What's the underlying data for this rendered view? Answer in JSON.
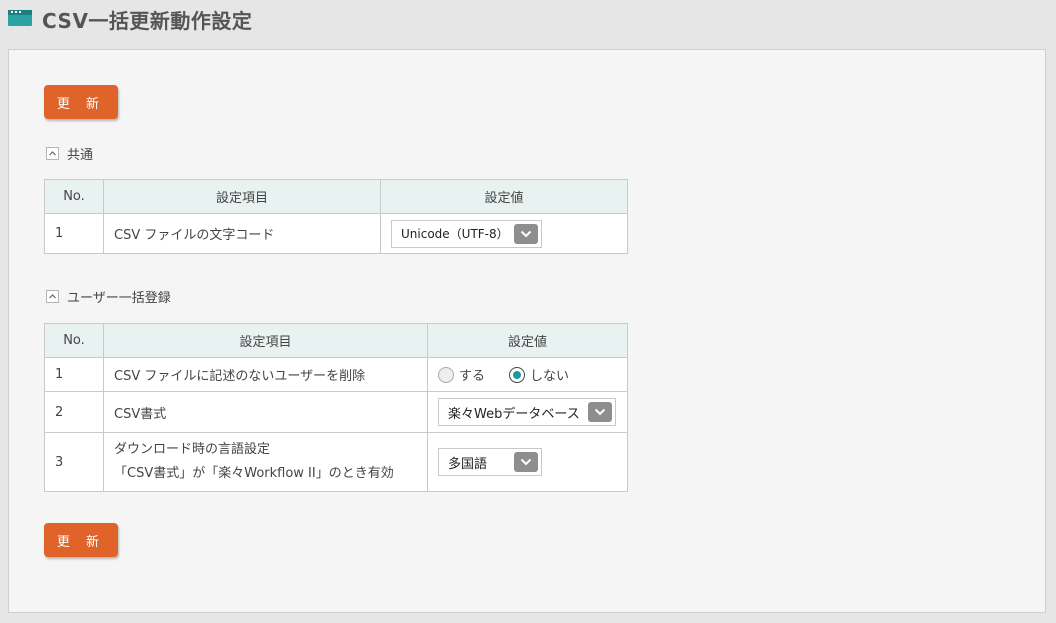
{
  "header": {
    "title": "CSV一括更新動作設定",
    "icon": "window-icon",
    "accent_color": "#2ba3a3"
  },
  "buttons": {
    "update_top": "更 新",
    "update_bottom": "更 新",
    "color": "#e06429"
  },
  "sections": [
    {
      "label": "共通",
      "columns": [
        "No.",
        "設定項目",
        "設定値"
      ],
      "rows": [
        {
          "no": "1",
          "item": "CSV ファイルの文字コード",
          "value": "Unicode（UTF-8）"
        }
      ]
    },
    {
      "label": "ユーザー一括登録",
      "columns": [
        "No.",
        "設定項目",
        "設定値"
      ],
      "rows": [
        {
          "no": "1",
          "item": "CSV ファイルに記述のないユーザーを削除",
          "options": [
            "する",
            "しない"
          ],
          "selected": "しない"
        },
        {
          "no": "2",
          "item": "CSV書式",
          "value": "楽々Webデータベース"
        },
        {
          "no": "3",
          "item_line1": "ダウンロード時の言語設定",
          "item_line2": "「CSV書式」が「楽々Workflow II」のとき有効",
          "value": "多国語"
        }
      ]
    }
  ]
}
